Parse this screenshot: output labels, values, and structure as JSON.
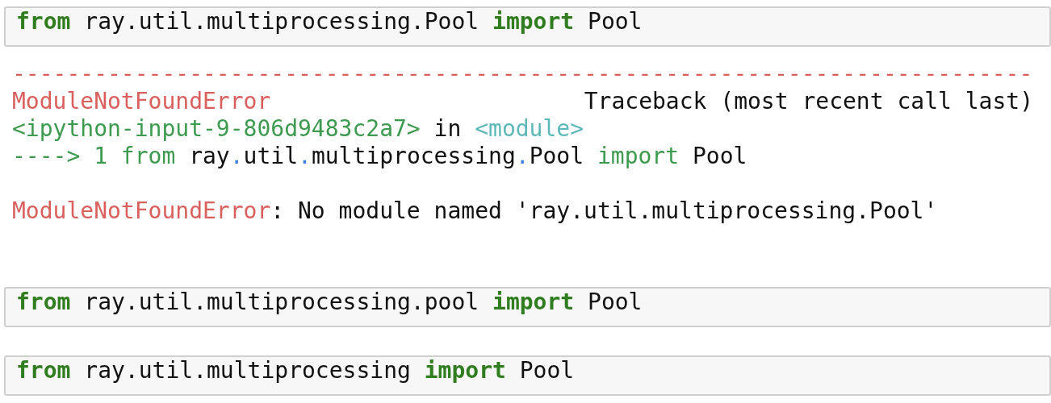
{
  "cells": [
    {
      "kind": "code",
      "tokens": [
        {
          "text": "from",
          "kind": "keyword"
        },
        {
          "text": " ray.util.multiprocessing.Pool ",
          "kind": "plain"
        },
        {
          "text": "import",
          "kind": "keyword"
        },
        {
          "text": " Pool",
          "kind": "plain"
        }
      ],
      "output": {
        "separator": "---------------------------------------------------------------------------",
        "error_name": "ModuleNotFoundError",
        "header": "Traceback (most recent call last)",
        "lines": [
          [
            {
              "text": "<ipython-input-9-806d9483c2a7>",
              "kind": "location"
            },
            {
              "text": " in ",
              "kind": "plain"
            },
            {
              "text": "<module>",
              "kind": "name"
            }
          ],
          [
            {
              "text": "----> 1 ",
              "kind": "arrow"
            },
            {
              "text": "from",
              "kind": "arrow"
            },
            {
              "text": " ray",
              "kind": "plain"
            },
            {
              "text": ".",
              "kind": "dot"
            },
            {
              "text": "util",
              "kind": "plain"
            },
            {
              "text": ".",
              "kind": "dot"
            },
            {
              "text": "multiprocessing",
              "kind": "plain"
            },
            {
              "text": ".",
              "kind": "dot"
            },
            {
              "text": "Pool ",
              "kind": "plain"
            },
            {
              "text": "import",
              "kind": "arrow"
            },
            {
              "text": " Pool",
              "kind": "plain"
            }
          ],
          [
            {
              "text": "ModuleNotFoundError",
              "kind": "error"
            },
            {
              "text": ": No module named 'ray.util.multiprocessing.Pool'",
              "kind": "plain"
            }
          ]
        ]
      }
    },
    {
      "kind": "code",
      "tokens": [
        {
          "text": "from",
          "kind": "keyword"
        },
        {
          "text": " ray.util.multiprocessing.pool ",
          "kind": "plain"
        },
        {
          "text": "import",
          "kind": "keyword"
        },
        {
          "text": " Pool",
          "kind": "plain"
        }
      ]
    },
    {
      "kind": "code",
      "tokens": [
        {
          "text": "from",
          "kind": "keyword"
        },
        {
          "text": " ray.util.multiprocessing ",
          "kind": "plain"
        },
        {
          "text": "import",
          "kind": "keyword"
        },
        {
          "text": " Pool",
          "kind": "plain"
        }
      ]
    }
  ]
}
